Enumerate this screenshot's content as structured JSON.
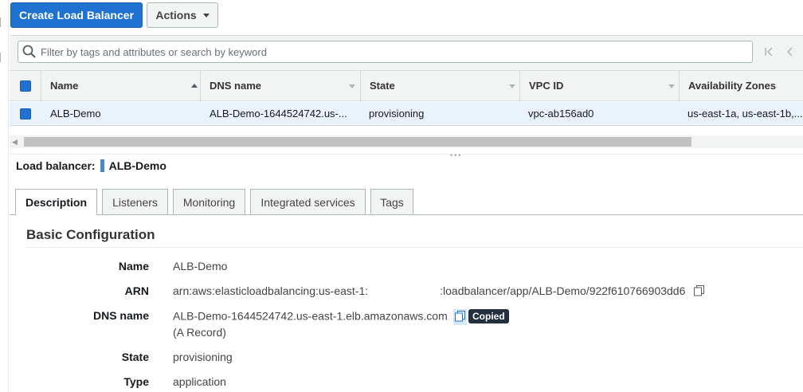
{
  "toolbar": {
    "create_label": "Create Load Balancer",
    "actions_label": "Actions"
  },
  "search": {
    "placeholder": "Filter by tags and attributes or search by keyword"
  },
  "table": {
    "columns": [
      "Name",
      "DNS name",
      "State",
      "VPC ID",
      "Availability Zones"
    ],
    "rows": [
      {
        "name": "ALB-Demo",
        "dns": "ALB-Demo-1644524742.us-...",
        "state": "provisioning",
        "vpc": "vpc-ab156ad0",
        "az": "us-east-1a, us-east-1b,..."
      }
    ]
  },
  "detail": {
    "header_label": "Load balancer:",
    "header_name": "ALB-Demo",
    "tabs": [
      "Description",
      "Listeners",
      "Monitoring",
      "Integrated services",
      "Tags"
    ],
    "section_title": "Basic Configuration",
    "fields": {
      "name_label": "Name",
      "name_value": "ALB-Demo",
      "arn_label": "ARN",
      "arn_prefix": "arn:aws:elasticloadbalancing:us-east-1:",
      "arn_suffix": ":loadbalancer/app/ALB-Demo/922f610766903dd6",
      "dns_label": "DNS name",
      "dns_value": "ALB-Demo-1644524742.us-east-1.elb.amazonaws.com",
      "dns_record": "(A Record)",
      "copied_badge": "Copied",
      "state_label": "State",
      "state_value": "provisioning",
      "type_label": "Type",
      "type_value": "application"
    }
  },
  "colors": {
    "primary": "#1f72d0",
    "selected_row": "#eaf3fb",
    "badge_bg": "#232f3e"
  }
}
